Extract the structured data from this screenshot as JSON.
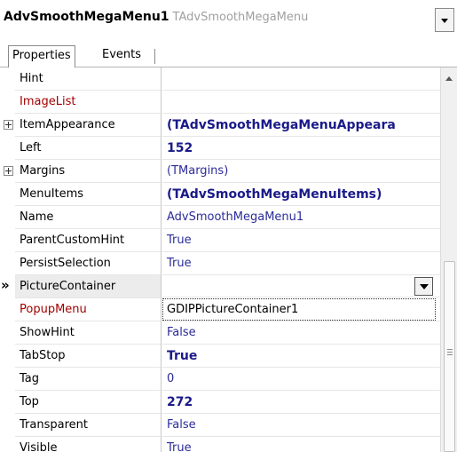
{
  "header": {
    "component_name": "AdvSmoothMegaMenu1",
    "component_type": "TAdvSmoothMegaMenu"
  },
  "tabs": [
    {
      "label": "Properties",
      "active": true
    },
    {
      "label": "Events",
      "active": false
    }
  ],
  "properties": [
    {
      "name": "Hint",
      "value": "",
      "style": "normal",
      "name_color": "black",
      "expandable": false
    },
    {
      "name": "ImageList",
      "value": "",
      "style": "normal",
      "name_color": "red",
      "expandable": false
    },
    {
      "name": "ItemAppearance",
      "value": "(TAdvSmoothMegaMenuAppeara",
      "style": "bold",
      "name_color": "black",
      "expandable": true
    },
    {
      "name": "Left",
      "value": "152",
      "style": "bold",
      "name_color": "black",
      "expandable": false
    },
    {
      "name": "Margins",
      "value": "(TMargins)",
      "style": "normal",
      "name_color": "black",
      "expandable": true
    },
    {
      "name": "MenuItems",
      "value": "(TAdvSmoothMegaMenuItems)",
      "style": "bold",
      "name_color": "black",
      "expandable": false
    },
    {
      "name": "Name",
      "value": "AdvSmoothMegaMenu1",
      "style": "normal",
      "name_color": "black",
      "expandable": false
    },
    {
      "name": "ParentCustomHint",
      "value": "True",
      "style": "normal",
      "name_color": "black",
      "expandable": false
    },
    {
      "name": "PersistSelection",
      "value": "True",
      "style": "normal",
      "name_color": "black",
      "expandable": false
    },
    {
      "name": "PictureContainer",
      "value": "",
      "style": "normal",
      "name_color": "black",
      "expandable": false,
      "selected": true
    },
    {
      "name": "PopupMenu",
      "value": "",
      "style": "normal",
      "name_color": "red",
      "expandable": false
    },
    {
      "name": "ShowHint",
      "value": "False",
      "style": "normal",
      "name_color": "black",
      "expandable": false
    },
    {
      "name": "TabStop",
      "value": "True",
      "style": "bold",
      "name_color": "black",
      "expandable": false
    },
    {
      "name": "Tag",
      "value": "0",
      "style": "normal",
      "name_color": "black",
      "expandable": false
    },
    {
      "name": "Top",
      "value": "272",
      "style": "bold",
      "name_color": "black",
      "expandable": false
    },
    {
      "name": "Transparent",
      "value": "False",
      "style": "normal",
      "name_color": "black",
      "expandable": false
    },
    {
      "name": "Visible",
      "value": "True",
      "style": "normal",
      "name_color": "black",
      "expandable": false
    }
  ],
  "dropdown": {
    "items": [
      "GDIPPictureContainer1"
    ]
  },
  "selected_marker": "»",
  "icons": {
    "object_dropdown": "chevron-down-icon",
    "expand": "plus-box-icon",
    "row_pointer": "double-chevron-right-icon",
    "scroll_up": "arrow-up-icon"
  },
  "colors": {
    "name_red": "#a30000",
    "value_blue": "#2b2b9a",
    "value_bold_blue": "#1a1a8a"
  }
}
